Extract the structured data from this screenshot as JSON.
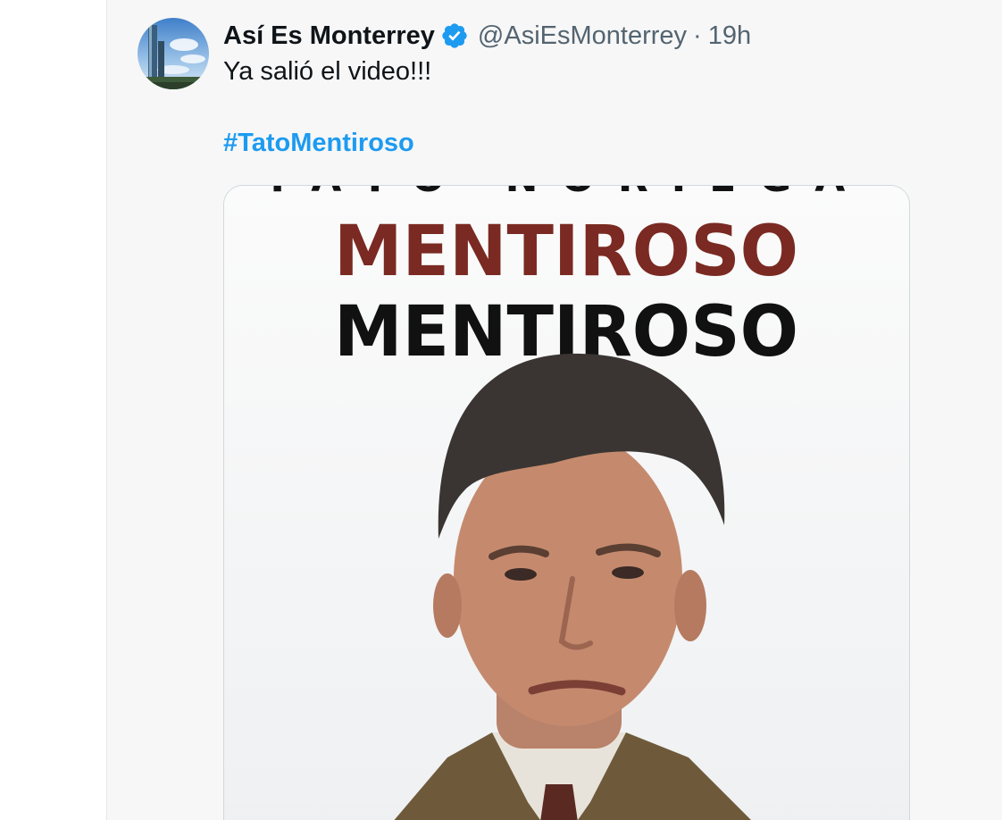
{
  "tweet": {
    "display_name": "Así Es Monterrey",
    "handle": "@AsiEsMonterrey",
    "separator": "·",
    "time": "19h",
    "text": "Ya salió el video!!!",
    "hashtag": "#TatoMentiroso",
    "verified_icon": "verified-badge-icon"
  },
  "media": {
    "top_text": "TATO NORIEGA",
    "line1": "MENTIROSO",
    "line2": "MENTIROSO"
  },
  "colors": {
    "accent": "#1d9bf0",
    "title_red": "#7a2a22",
    "title_black": "#111111",
    "text_primary": "#0f1419",
    "text_secondary": "#536471"
  }
}
